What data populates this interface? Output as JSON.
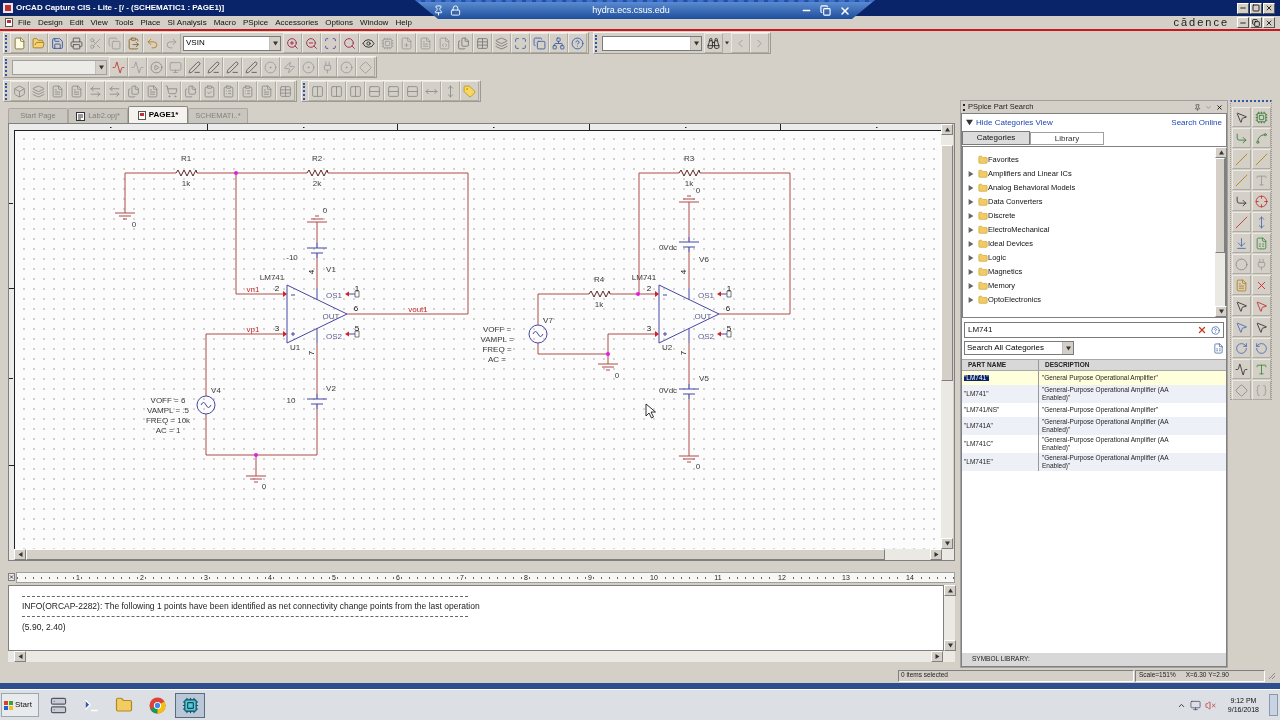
{
  "window": {
    "title": "OrCAD Capture CIS - Lite - [/ - (SCHEMATIC1 : PAGE1)]"
  },
  "remote_bar": {
    "host": "hydra.ecs.csus.edu"
  },
  "menu": [
    "File",
    "Design",
    "Edit",
    "View",
    "Tools",
    "Place",
    "SI Analysis",
    "Macro",
    "PSpice",
    "Accessories",
    "Options",
    "Window",
    "Help"
  ],
  "logo": "cādence",
  "toolbar": {
    "part_combo": "VSIN"
  },
  "doc_tabs": [
    {
      "label": "Start Page",
      "kind": "start",
      "selected": false
    },
    {
      "label": "Lab2.opj*",
      "kind": "project",
      "selected": false
    },
    {
      "label": "PAGE1*",
      "kind": "page",
      "selected": true
    },
    {
      "label": "SCHEMATI..*",
      "kind": "schematic",
      "selected": false
    }
  ],
  "schematic": {
    "circuits": [
      {
        "resistors": [
          {
            "ref": "R1",
            "value": "1k"
          },
          {
            "ref": "R2",
            "value": "2k"
          }
        ],
        "opamp": {
          "part": "LM741",
          "ref": "U1",
          "pin_numbers": [
            "4",
            "2",
            "1",
            "6",
            "3",
            "5",
            "7"
          ],
          "pin_names": [
            "OS1",
            "OUT",
            "OS2"
          ]
        },
        "net_labels": [
          "vn1",
          "vp1",
          "vout1"
        ],
        "dc_sources": [
          {
            "ref": "V1",
            "value": "-10"
          },
          {
            "ref": "V2",
            "value": "10"
          }
        ],
        "ac_source": {
          "ref": "V4",
          "params": [
            "VOFF = 6",
            "VAMPL = .5",
            "FREQ = 10k",
            "AC = 1"
          ]
        },
        "grounds": [
          "0",
          "0",
          "0"
        ]
      },
      {
        "resistors": [
          {
            "ref": "R3",
            "value": "1k"
          },
          {
            "ref": "R4",
            "value": "1k"
          }
        ],
        "opamp": {
          "part": "LM741",
          "ref": "U2",
          "pin_numbers": [
            "4",
            "2",
            "1",
            "6",
            "3",
            "5",
            "7"
          ],
          "pin_names": [
            "OS1",
            "OUT",
            "OS2"
          ]
        },
        "dc_sources": [
          {
            "ref": "V6",
            "value": "0Vdc"
          },
          {
            "ref": "V5",
            "value": "0Vdc"
          }
        ],
        "ac_source": {
          "ref": "V7",
          "params": [
            "VOFF =",
            "VAMPL =",
            "FREQ =",
            "AC ="
          ]
        },
        "grounds": [
          "0",
          "0",
          "0"
        ]
      }
    ]
  },
  "ruler": [
    "1",
    "2",
    "3",
    "4",
    "5",
    "6",
    "7",
    "8",
    "9",
    "10",
    "11",
    "12",
    "13",
    "14"
  ],
  "log": [
    "INFO(ORCAP-2282): The following 1 points have been identified as net connectivity change points from the last operation",
    "(5.90, 2.40)"
  ],
  "part_search": {
    "title": "PSpice Part Search",
    "toggle": "Hide Categories View",
    "online": "Search Online",
    "tabs": [
      {
        "label": "Categories",
        "selected": true
      },
      {
        "label": "Library",
        "selected": false
      }
    ],
    "categories": [
      {
        "label": "Favorites",
        "kind": "plain"
      },
      {
        "label": "Amplifiers and Linear ICs",
        "kind": "group",
        "expanded": false
      },
      {
        "label": "Analog Behavioral Models",
        "kind": "group",
        "expanded": false
      },
      {
        "label": "Data Converters",
        "kind": "group",
        "expanded": false
      },
      {
        "label": "Discrete",
        "kind": "group",
        "expanded": false
      },
      {
        "label": "ElectroMechanical",
        "kind": "group",
        "expanded": false
      },
      {
        "label": "Ideal Devices",
        "kind": "group",
        "expanded": false
      },
      {
        "label": "Logic",
        "kind": "group",
        "expanded": false
      },
      {
        "label": "Magnetics",
        "kind": "group",
        "expanded": false
      },
      {
        "label": "Memory",
        "kind": "group",
        "expanded": false
      },
      {
        "label": "OptoElectronics",
        "kind": "group",
        "expanded": false
      }
    ],
    "search": {
      "value": "LM741"
    },
    "filter": {
      "value": "Search All Categories"
    },
    "columns": [
      "PART NAME",
      "DESCRIPTION"
    ],
    "rows": [
      {
        "part": "\"LM741\"",
        "description": "\"General Purpose Operational Amplifier\"",
        "selected": true
      },
      {
        "part": "\"LM741\"",
        "description": "\"General-Purpose Operational Amplifier (AA Enabled)\"",
        "selected": false
      },
      {
        "part": "\"LM741/NS\"",
        "description": "\"General-Purpose Operational Amplifier\"",
        "selected": false
      },
      {
        "part": "\"LM741A\"",
        "description": "\"General-Purpose Operational Amplifier (AA Enabled)\"",
        "selected": false
      },
      {
        "part": "\"LM741C\"",
        "description": "\"General-Purpose Operational Amplifier (AA Enabled)\"",
        "selected": false
      },
      {
        "part": "\"LM741E\"",
        "description": "\"General-Purpose Operational Amplifier (AA Enabled)\"",
        "selected": false
      }
    ],
    "footer": "SYMBOL LIBRARY:"
  },
  "status_bar": {
    "selection": "0 items selected",
    "scale": "Scale=151%",
    "coords": "X=6.30 Y=2.90"
  },
  "taskbar": {
    "start": "Start",
    "time": "9:12 PM",
    "date": "9/16/2018"
  }
}
